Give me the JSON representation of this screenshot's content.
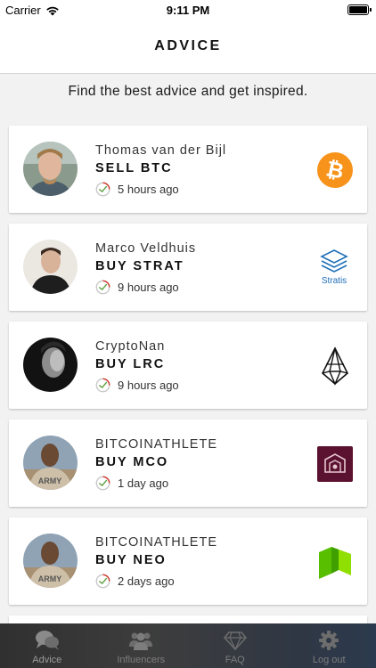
{
  "status_bar": {
    "carrier": "Carrier",
    "time": "9:11 PM"
  },
  "nav": {
    "title": "ADVICE"
  },
  "subtitle": "Find the best advice and get inspired.",
  "cards": [
    {
      "name": "Thomas van der Bijl",
      "action": "SELL BTC",
      "time": "5 hours ago",
      "coin_icon": "bitcoin-icon"
    },
    {
      "name": "Marco Veldhuis",
      "action": "BUY STRAT",
      "time": "9 hours ago",
      "coin_icon": "stratis-icon",
      "coin_label": "Stratis"
    },
    {
      "name": "CryptoNan",
      "action": "BUY LRC",
      "time": "9 hours ago",
      "coin_icon": "loopring-icon"
    },
    {
      "name": "BITCOINATHLETE",
      "action": "BUY MCO",
      "time": "1 day ago",
      "coin_icon": "monaco-icon"
    },
    {
      "name": "BITCOINATHLETE",
      "action": "BUY NEO",
      "time": "2 days ago",
      "coin_icon": "neo-icon"
    }
  ],
  "tabs": [
    {
      "label": "Advice",
      "icon": "chat-bubbles-icon",
      "active": true
    },
    {
      "label": "Influencers",
      "icon": "people-icon",
      "active": false
    },
    {
      "label": "FAQ",
      "icon": "diamond-icon",
      "active": false
    },
    {
      "label": "Log out",
      "icon": "gear-icon",
      "active": false
    }
  ],
  "colors": {
    "bitcoin": "#f7931a",
    "stratis": "#1d6fb8",
    "monaco": "#5a1230",
    "neo": "#58bf00",
    "clock_red": "#d0342c",
    "clock_green": "#5a9e3a"
  }
}
